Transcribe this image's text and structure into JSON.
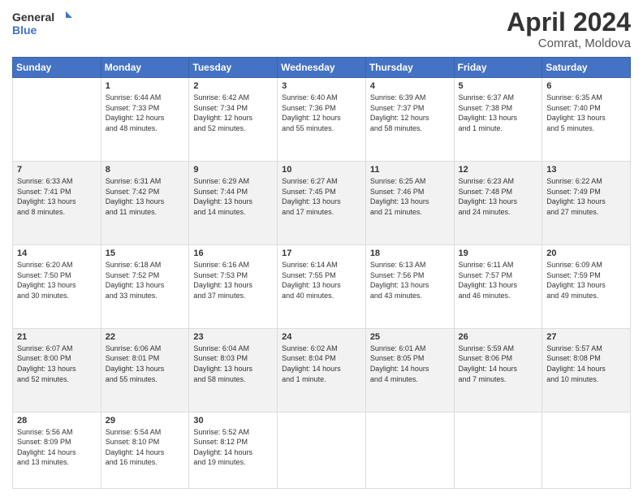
{
  "header": {
    "logo_line1": "General",
    "logo_line2": "Blue",
    "title": "April 2024",
    "subtitle": "Comrat, Moldova"
  },
  "days_of_week": [
    "Sunday",
    "Monday",
    "Tuesday",
    "Wednesday",
    "Thursday",
    "Friday",
    "Saturday"
  ],
  "weeks": [
    [
      {
        "day": "",
        "info": ""
      },
      {
        "day": "1",
        "info": "Sunrise: 6:44 AM\nSunset: 7:33 PM\nDaylight: 12 hours\nand 48 minutes."
      },
      {
        "day": "2",
        "info": "Sunrise: 6:42 AM\nSunset: 7:34 PM\nDaylight: 12 hours\nand 52 minutes."
      },
      {
        "day": "3",
        "info": "Sunrise: 6:40 AM\nSunset: 7:36 PM\nDaylight: 12 hours\nand 55 minutes."
      },
      {
        "day": "4",
        "info": "Sunrise: 6:39 AM\nSunset: 7:37 PM\nDaylight: 12 hours\nand 58 minutes."
      },
      {
        "day": "5",
        "info": "Sunrise: 6:37 AM\nSunset: 7:38 PM\nDaylight: 13 hours\nand 1 minute."
      },
      {
        "day": "6",
        "info": "Sunrise: 6:35 AM\nSunset: 7:40 PM\nDaylight: 13 hours\nand 5 minutes."
      }
    ],
    [
      {
        "day": "7",
        "info": "Sunrise: 6:33 AM\nSunset: 7:41 PM\nDaylight: 13 hours\nand 8 minutes."
      },
      {
        "day": "8",
        "info": "Sunrise: 6:31 AM\nSunset: 7:42 PM\nDaylight: 13 hours\nand 11 minutes."
      },
      {
        "day": "9",
        "info": "Sunrise: 6:29 AM\nSunset: 7:44 PM\nDaylight: 13 hours\nand 14 minutes."
      },
      {
        "day": "10",
        "info": "Sunrise: 6:27 AM\nSunset: 7:45 PM\nDaylight: 13 hours\nand 17 minutes."
      },
      {
        "day": "11",
        "info": "Sunrise: 6:25 AM\nSunset: 7:46 PM\nDaylight: 13 hours\nand 21 minutes."
      },
      {
        "day": "12",
        "info": "Sunrise: 6:23 AM\nSunset: 7:48 PM\nDaylight: 13 hours\nand 24 minutes."
      },
      {
        "day": "13",
        "info": "Sunrise: 6:22 AM\nSunset: 7:49 PM\nDaylight: 13 hours\nand 27 minutes."
      }
    ],
    [
      {
        "day": "14",
        "info": "Sunrise: 6:20 AM\nSunset: 7:50 PM\nDaylight: 13 hours\nand 30 minutes."
      },
      {
        "day": "15",
        "info": "Sunrise: 6:18 AM\nSunset: 7:52 PM\nDaylight: 13 hours\nand 33 minutes."
      },
      {
        "day": "16",
        "info": "Sunrise: 6:16 AM\nSunset: 7:53 PM\nDaylight: 13 hours\nand 37 minutes."
      },
      {
        "day": "17",
        "info": "Sunrise: 6:14 AM\nSunset: 7:55 PM\nDaylight: 13 hours\nand 40 minutes."
      },
      {
        "day": "18",
        "info": "Sunrise: 6:13 AM\nSunset: 7:56 PM\nDaylight: 13 hours\nand 43 minutes."
      },
      {
        "day": "19",
        "info": "Sunrise: 6:11 AM\nSunset: 7:57 PM\nDaylight: 13 hours\nand 46 minutes."
      },
      {
        "day": "20",
        "info": "Sunrise: 6:09 AM\nSunset: 7:59 PM\nDaylight: 13 hours\nand 49 minutes."
      }
    ],
    [
      {
        "day": "21",
        "info": "Sunrise: 6:07 AM\nSunset: 8:00 PM\nDaylight: 13 hours\nand 52 minutes."
      },
      {
        "day": "22",
        "info": "Sunrise: 6:06 AM\nSunset: 8:01 PM\nDaylight: 13 hours\nand 55 minutes."
      },
      {
        "day": "23",
        "info": "Sunrise: 6:04 AM\nSunset: 8:03 PM\nDaylight: 13 hours\nand 58 minutes."
      },
      {
        "day": "24",
        "info": "Sunrise: 6:02 AM\nSunset: 8:04 PM\nDaylight: 14 hours\nand 1 minute."
      },
      {
        "day": "25",
        "info": "Sunrise: 6:01 AM\nSunset: 8:05 PM\nDaylight: 14 hours\nand 4 minutes."
      },
      {
        "day": "26",
        "info": "Sunrise: 5:59 AM\nSunset: 8:06 PM\nDaylight: 14 hours\nand 7 minutes."
      },
      {
        "day": "27",
        "info": "Sunrise: 5:57 AM\nSunset: 8:08 PM\nDaylight: 14 hours\nand 10 minutes."
      }
    ],
    [
      {
        "day": "28",
        "info": "Sunrise: 5:56 AM\nSunset: 8:09 PM\nDaylight: 14 hours\nand 13 minutes."
      },
      {
        "day": "29",
        "info": "Sunrise: 5:54 AM\nSunset: 8:10 PM\nDaylight: 14 hours\nand 16 minutes."
      },
      {
        "day": "30",
        "info": "Sunrise: 5:52 AM\nSunset: 8:12 PM\nDaylight: 14 hours\nand 19 minutes."
      },
      {
        "day": "",
        "info": ""
      },
      {
        "day": "",
        "info": ""
      },
      {
        "day": "",
        "info": ""
      },
      {
        "day": "",
        "info": ""
      }
    ]
  ]
}
